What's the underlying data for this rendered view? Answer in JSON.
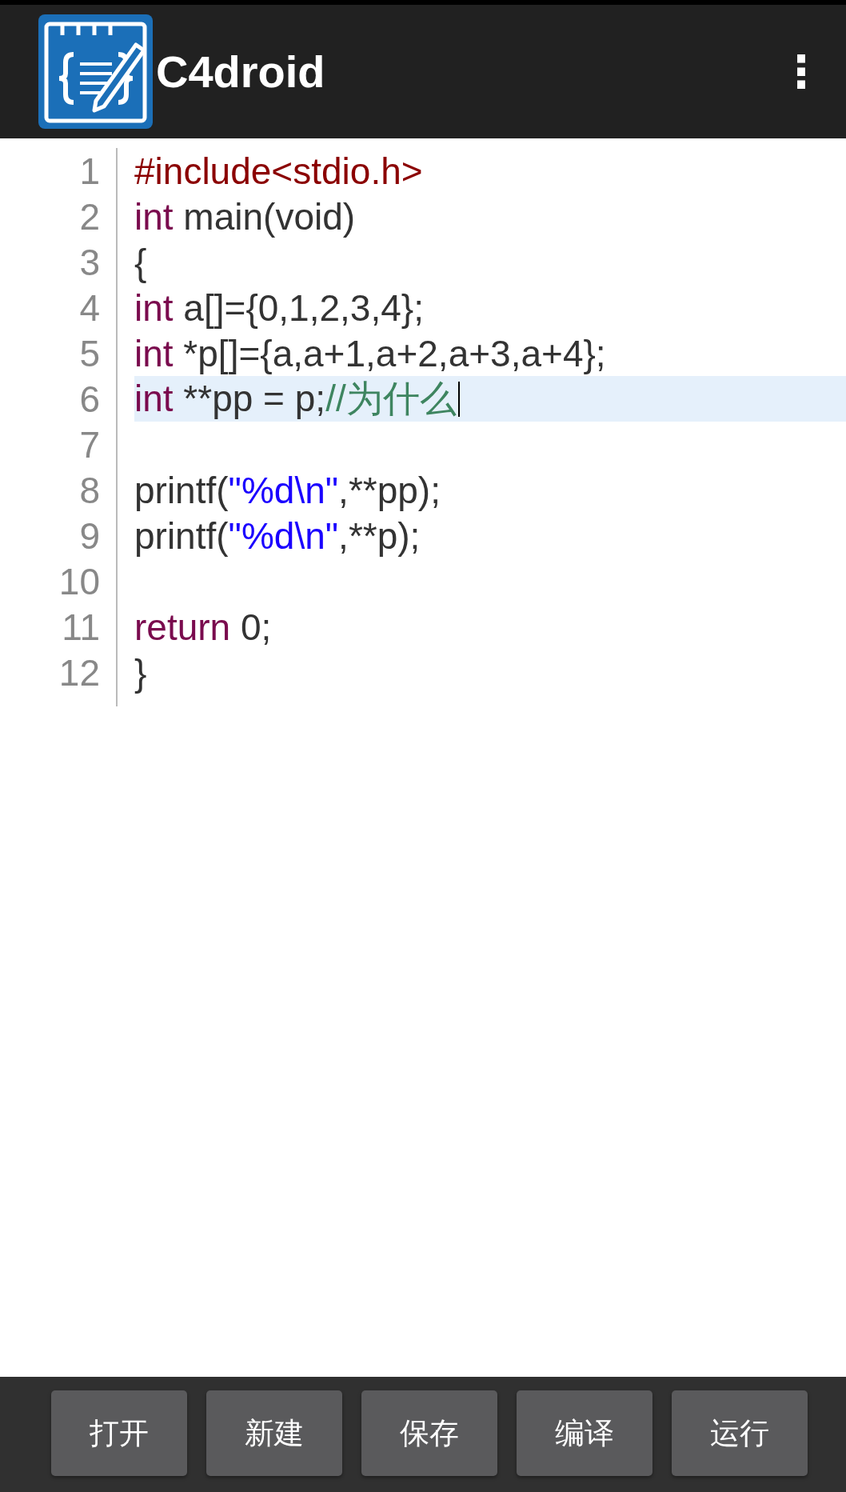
{
  "app_bar": {
    "title": "C4droid",
    "menu_icon": "⋮"
  },
  "editor": {
    "lines": [
      {
        "number": "1",
        "current": false,
        "tokens": [
          {
            "kind": "preprocessor",
            "text": "#include<stdio.h>"
          }
        ]
      },
      {
        "number": "2",
        "current": false,
        "tokens": [
          {
            "kind": "keyword",
            "text": "int"
          },
          {
            "kind": "plain",
            "text": " main(void)"
          }
        ]
      },
      {
        "number": "3",
        "current": false,
        "tokens": [
          {
            "kind": "plain",
            "text": "{"
          }
        ]
      },
      {
        "number": "4",
        "current": false,
        "tokens": [
          {
            "kind": "keyword",
            "text": "int"
          },
          {
            "kind": "plain",
            "text": " a[]={0,1,2,3,4};"
          }
        ]
      },
      {
        "number": "5",
        "current": false,
        "tokens": [
          {
            "kind": "keyword",
            "text": "int"
          },
          {
            "kind": "plain",
            "text": " *p[]={a,a+1,a+2,a+3,a+4};"
          }
        ]
      },
      {
        "number": "6",
        "current": true,
        "tokens": [
          {
            "kind": "keyword",
            "text": "int"
          },
          {
            "kind": "plain",
            "text": " **pp = p;"
          },
          {
            "kind": "comment",
            "text": "//为什么"
          }
        ]
      },
      {
        "number": "7",
        "current": false
      },
      {
        "number": "8",
        "current": false,
        "tokens": [
          {
            "kind": "plain",
            "text": "printf("
          },
          {
            "kind": "string",
            "text": "\"%d\\n\""
          },
          {
            "kind": "plain",
            "text": ",**pp);"
          }
        ]
      },
      {
        "number": "9",
        "current": false,
        "tokens": [
          {
            "kind": "plain",
            "text": "printf("
          },
          {
            "kind": "string",
            "text": "\"%d\\n\""
          },
          {
            "kind": "plain",
            "text": ",**p);"
          }
        ]
      },
      {
        "number": "10",
        "current": false
      },
      {
        "number": "11",
        "current": false,
        "tokens": [
          {
            "kind": "keyword",
            "text": "return"
          },
          {
            "kind": "plain",
            "text": " 0;"
          }
        ]
      },
      {
        "number": "12",
        "current": false,
        "tokens": [
          {
            "kind": "plain",
            "text": "}"
          }
        ]
      }
    ]
  },
  "toolbar": {
    "buttons": [
      "打开",
      "新建",
      "保存",
      "编译",
      "运行"
    ]
  }
}
